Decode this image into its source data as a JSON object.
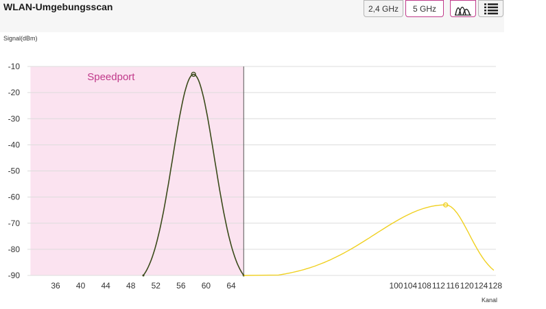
{
  "header": {
    "title": "WLAN-Umgebungsscan",
    "band_buttons": [
      {
        "label": "2,4 GHz",
        "selected": false
      },
      {
        "label": "5 GHz",
        "selected": true
      }
    ],
    "view_buttons": [
      {
        "icon": "chart-view-icon",
        "selected": true
      },
      {
        "icon": "list-view-icon",
        "selected": false
      }
    ]
  },
  "colors": {
    "accent": "#c0398a",
    "highlight_band": "#fbe3f0",
    "own_network": "#3a4a1a",
    "other_network": "#f0d020"
  },
  "chart_data": {
    "type": "line",
    "ylabel": "Signal(dBm)",
    "xlabel": "Kanal",
    "ylim": [
      -90,
      -10
    ],
    "y_ticks": [
      "-10",
      "-20",
      "-30",
      "-40",
      "-50",
      "-60",
      "-70",
      "-80",
      "-90"
    ],
    "x_ticks": [
      "36",
      "40",
      "44",
      "48",
      "52",
      "56",
      "60",
      "64",
      "100",
      "104",
      "108",
      "112",
      "116",
      "120",
      "124",
      "128"
    ],
    "grid": true,
    "highlight": {
      "label": "Speedport",
      "from_channel": 32,
      "to_channel": 66
    },
    "series": [
      {
        "name": "Speedport",
        "color": "#3a4a1a",
        "start_channel": 50,
        "center_channel": 58,
        "end_channel": 66,
        "peak_dbm": -13
      },
      {
        "color": "#f0d020",
        "start_channel": 66,
        "center_channel": 114,
        "end_channel": 130,
        "peak_dbm": -63
      }
    ]
  }
}
